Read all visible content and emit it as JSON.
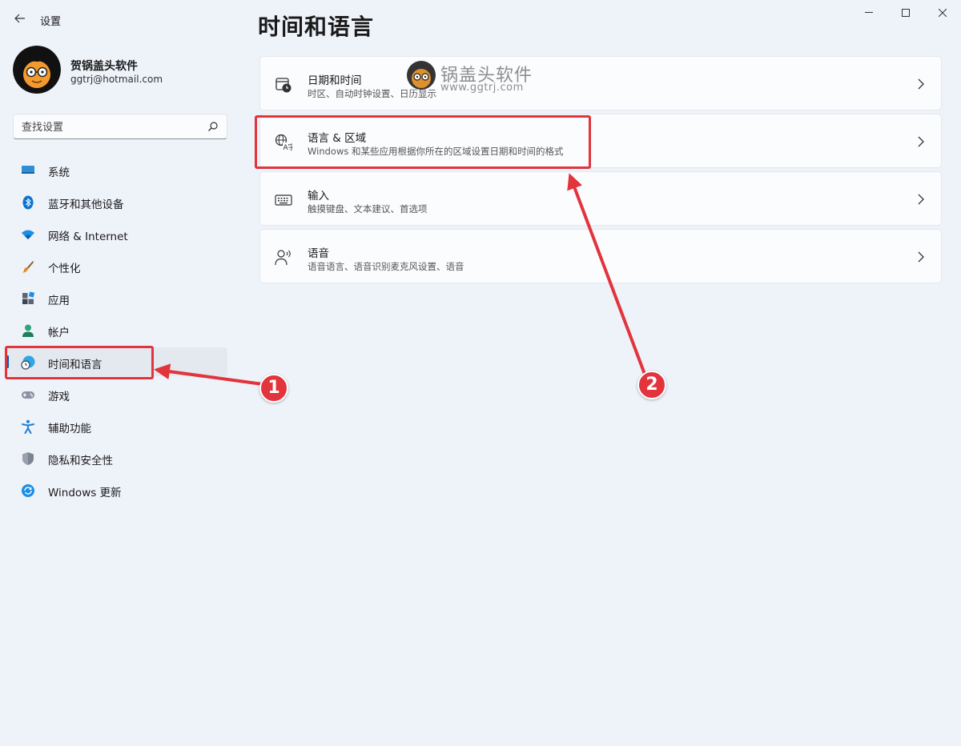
{
  "window": {
    "title": "设置",
    "controls": [
      "minimize",
      "maximize",
      "close"
    ]
  },
  "profile": {
    "name": "贺锅盖头软件",
    "email": "ggtrj@hotmail.com"
  },
  "search": {
    "placeholder": "查找设置"
  },
  "sidebar": {
    "items": [
      {
        "label": "系统",
        "icon": "monitor-icon"
      },
      {
        "label": "蓝牙和其他设备",
        "icon": "bluetooth-icon"
      },
      {
        "label": "网络 & Internet",
        "icon": "wifi-icon"
      },
      {
        "label": "个性化",
        "icon": "brush-icon"
      },
      {
        "label": "应用",
        "icon": "apps-icon"
      },
      {
        "label": "帐户",
        "icon": "person-icon"
      },
      {
        "label": "时间和语言",
        "icon": "globe-clock-icon",
        "active": true
      },
      {
        "label": "游戏",
        "icon": "gamepad-icon"
      },
      {
        "label": "辅助功能",
        "icon": "accessibility-icon"
      },
      {
        "label": "隐私和安全性",
        "icon": "shield-icon"
      },
      {
        "label": "Windows 更新",
        "icon": "update-icon"
      }
    ]
  },
  "main": {
    "title": "时间和语言",
    "cards": [
      {
        "title": "日期和时间",
        "desc": "时区、自动时钟设置、日历显示",
        "icon": "calendar-clock-icon"
      },
      {
        "title": "语言 & 区域",
        "desc": "Windows 和某些应用根据你所在的区域设置日期和时间的格式",
        "icon": "language-icon"
      },
      {
        "title": "输入",
        "desc": "触摸键盘、文本建议、首选项",
        "icon": "keyboard-icon"
      },
      {
        "title": "语音",
        "desc": "语音语言、语音识别麦克风设置、语音",
        "icon": "speech-icon"
      }
    ]
  },
  "annotations": {
    "badges": [
      "1",
      "2"
    ],
    "color": "#e2343c"
  },
  "watermark": {
    "text": "锅盖头软件",
    "url": "www.ggtrj.com"
  },
  "colors": {
    "accent": "#005fb8",
    "background": "#eef2f9",
    "annotation": "#e2343c"
  }
}
